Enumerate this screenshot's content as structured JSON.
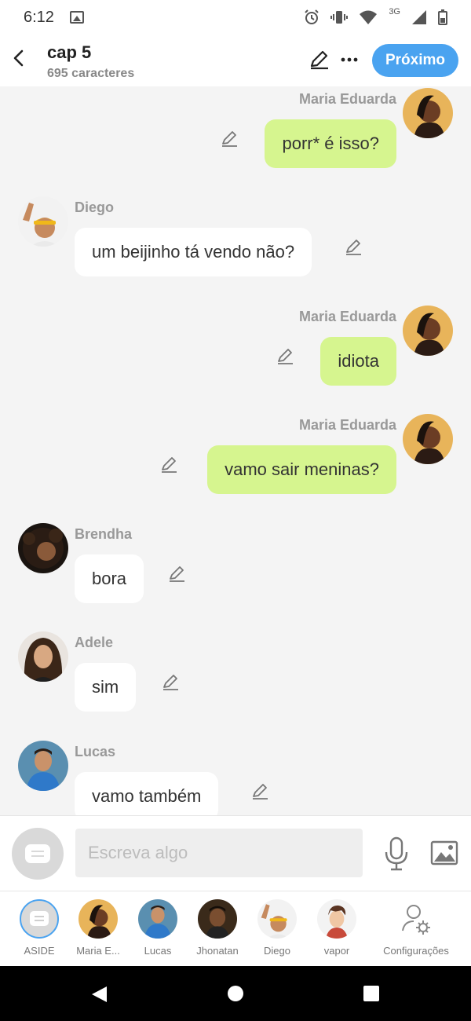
{
  "status_bar": {
    "time": "6:12",
    "network": "3G"
  },
  "header": {
    "title": "cap 5",
    "subtitle": "695 caracteres",
    "next_label": "Próximo"
  },
  "colors": {
    "accent": "#4aa3f0",
    "my_bubble": "#d6f58f",
    "other_bubble": "#ffffff"
  },
  "messages": [
    {
      "author": "Maria Eduarda",
      "text": "porr* é isso?",
      "side": "right"
    },
    {
      "author": "Diego",
      "text": "um beijinho tá vendo não?",
      "side": "left"
    },
    {
      "author": "Maria Eduarda",
      "text": "idiota",
      "side": "right"
    },
    {
      "author": "Maria Eduarda",
      "text": "vamo sair meninas?",
      "side": "right"
    },
    {
      "author": "Brendha",
      "text": "bora",
      "side": "left"
    },
    {
      "author": "Adele",
      "text": "sim",
      "side": "left"
    },
    {
      "author": "Lucas",
      "text": "vamo também",
      "side": "left"
    }
  ],
  "composer": {
    "placeholder": "Escreva algo"
  },
  "tabs": [
    {
      "label": "ASIDE",
      "icon": "aside-icon",
      "active": true
    },
    {
      "label": "Maria E...",
      "icon": "avatar-maria-eduarda"
    },
    {
      "label": "Lucas",
      "icon": "avatar-lucas"
    },
    {
      "label": "Jhonatan",
      "icon": "avatar-jhonatan"
    },
    {
      "label": "Diego",
      "icon": "avatar-diego"
    },
    {
      "label": "vapor",
      "icon": "avatar-vapor"
    },
    {
      "label": "Configurações",
      "icon": "settings-user-icon"
    }
  ]
}
